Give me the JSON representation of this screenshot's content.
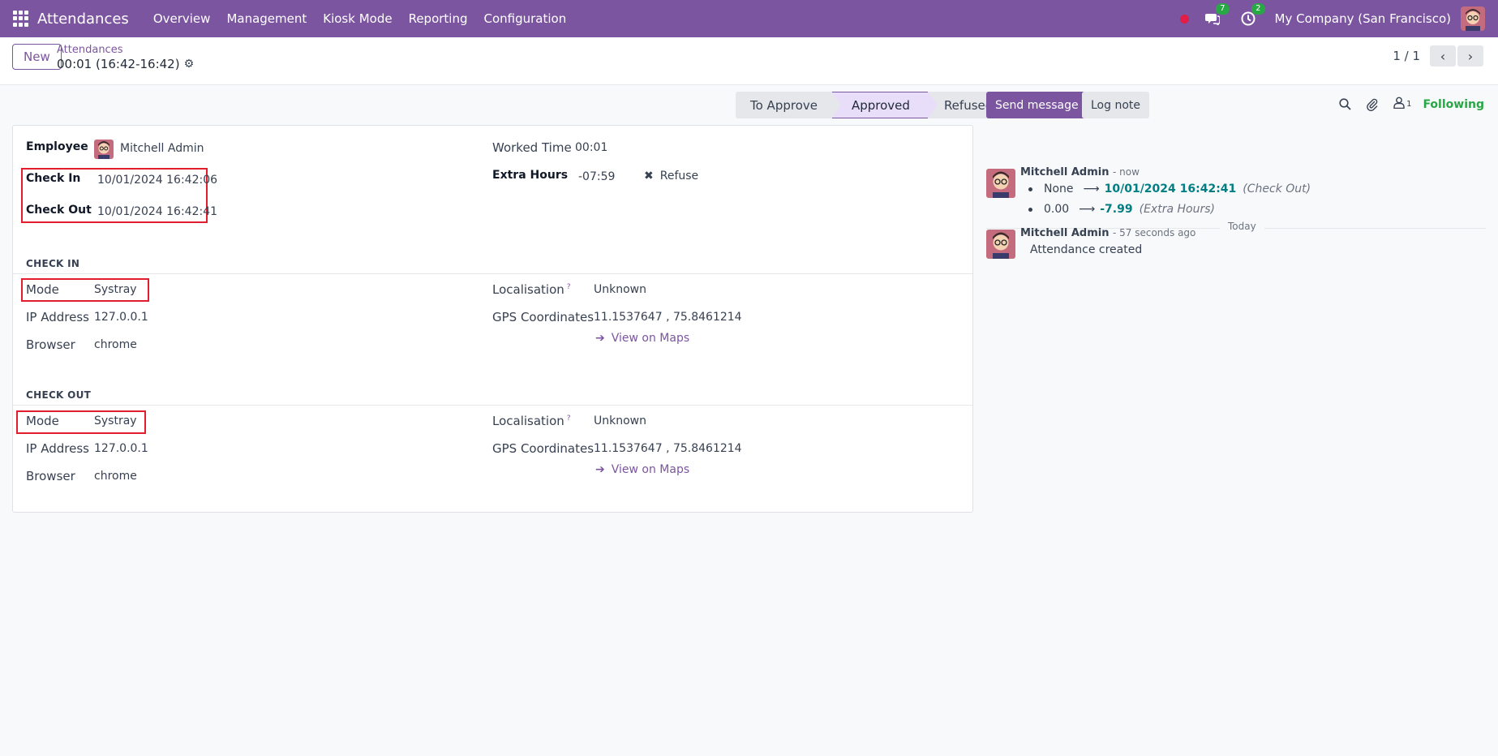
{
  "navbar": {
    "app_name": "Attendances",
    "menu": [
      "Overview",
      "Management",
      "Kiosk Mode",
      "Reporting",
      "Configuration"
    ],
    "messages_count": "7",
    "activities_count": "2",
    "company": "My Company (San Francisco)"
  },
  "control": {
    "new_label": "New",
    "breadcrumb": "Attendances",
    "record_title": "00:01 (16:42-16:42)",
    "pager": "1 / 1"
  },
  "statusbar": {
    "stages": [
      "To Approve",
      "Approved",
      "Refused"
    ],
    "active": "Approved"
  },
  "form": {
    "employee_label": "Employee",
    "employee_value": "Mitchell Admin",
    "check_in_label": "Check In",
    "check_in_value": "10/01/2024 16:42:06",
    "check_out_label": "Check Out",
    "check_out_value": "10/01/2024 16:42:41",
    "worked_time_label": "Worked Time",
    "worked_time_value": "00:01",
    "extra_hours_label": "Extra Hours",
    "extra_hours_value": "-07:59",
    "refuse_label": "Refuse",
    "check_in_section": {
      "title": "CHECK IN",
      "mode_label": "Mode",
      "mode_value": "Systray",
      "ip_label": "IP Address",
      "ip_value": "127.0.0.1",
      "browser_label": "Browser",
      "browser_value": "chrome",
      "localisation_label": "Localisation",
      "localisation_value": "Unknown",
      "gps_label": "GPS Coordinates",
      "gps_value": "11.1537647 , 75.8461214",
      "maps_link": "View on Maps"
    },
    "check_out_section": {
      "title": "CHECK OUT",
      "mode_label": "Mode",
      "mode_value": "Systray",
      "ip_label": "IP Address",
      "ip_value": "127.0.0.1",
      "browser_label": "Browser",
      "browser_value": "chrome",
      "localisation_label": "Localisation",
      "localisation_value": "Unknown",
      "gps_label": "GPS Coordinates",
      "gps_value": "11.1537647 , 75.8461214",
      "maps_link": "View on Maps"
    }
  },
  "chatter": {
    "send_message": "Send message",
    "log_note": "Log note",
    "followers_count": "1",
    "following": "Following",
    "day": "Today",
    "messages": [
      {
        "author": "Mitchell Admin",
        "time": "- now",
        "tracking": [
          {
            "old": "None",
            "new": "10/01/2024 16:42:41",
            "field": "(Check Out)"
          },
          {
            "old": "0.00",
            "new": "-7.99",
            "field": "(Extra Hours)"
          }
        ]
      },
      {
        "author": "Mitchell Admin",
        "time": "- 57 seconds ago",
        "body": "Attendance created"
      }
    ]
  },
  "colors": {
    "brand": "#7c55a0",
    "highlight_box": "#e11d2e",
    "following": "#28a745",
    "tracking_value": "#017e84"
  }
}
